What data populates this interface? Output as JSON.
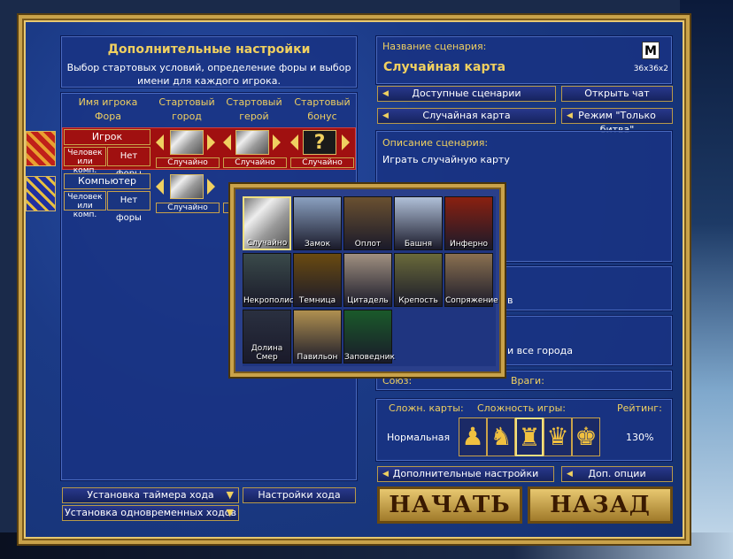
{
  "left": {
    "title": "Дополнительные настройки",
    "subtitle": "Выбор стартовых условий, определение форы и выбор имени для каждого игрока.",
    "columns": {
      "player": "Имя игрока\nФора",
      "town": "Стартовый\nгород",
      "hero": "Стартовый\nгерой",
      "bonus": "Стартовый\nбонус"
    },
    "players": [
      {
        "name": "Игрок",
        "type": "Человек\nили комп.",
        "handicap": "Нет форы",
        "town": "Случайно",
        "hero": "Случайно",
        "bonus": "Случайно",
        "flag_color": "#c0201a"
      },
      {
        "name": "Компьютер",
        "type": "Человек\nили комп.",
        "handicap": "Нет форы",
        "town": "Случайно",
        "hero": "",
        "bonus": "",
        "flag_color": "#2030a0"
      }
    ],
    "timer_label": "Установка таймера хода",
    "turn_settings": "Настройки хода",
    "simultaneous_label": "Установка одновременных ходов"
  },
  "right": {
    "scenario_name_label": "Название сценария:",
    "scenario_name": "Случайная карта",
    "map_size": "36x36x2",
    "map_icon_letter": "M",
    "available_scenarios": "Доступные сценарии",
    "open_chat": "Открыть чат",
    "random_map": "Случайная карта",
    "battle_only": "Режим \"Только битва\"",
    "description_label": "Описание сценария:",
    "description": "Играть случайную карту",
    "partial_text_1": "в",
    "partial_text_2": "и все города",
    "allies_label": "Союз:",
    "enemies_label": "Враги:",
    "map_difficulty_label": "Сложн. карты:",
    "game_difficulty_label": "Сложность игры:",
    "rating_label": "Рейтинг:",
    "map_difficulty": "Нормальная",
    "rating": "130%",
    "advanced_settings": "Дополнительные настройки",
    "extra_options": "Доп. опции",
    "start": "НАЧАТЬ",
    "back": "НАЗАД"
  },
  "towns": [
    {
      "name": "Случайно",
      "color": "#8a8a8a"
    },
    {
      "name": "Замок",
      "color": "#8aa0c0"
    },
    {
      "name": "Оплот",
      "color": "#6a5030"
    },
    {
      "name": "Башня",
      "color": "#b0c0d8"
    },
    {
      "name": "Инферно",
      "color": "#8a2010"
    },
    {
      "name": "Некрополис",
      "color": "#3a4a4a"
    },
    {
      "name": "Темница",
      "color": "#6a4a10"
    },
    {
      "name": "Цитадель",
      "color": "#a09080"
    },
    {
      "name": "Крепость",
      "color": "#6a6a3a"
    },
    {
      "name": "Сопряжение",
      "color": "#8a7050"
    },
    {
      "name": "Долина Смер",
      "color": "#2a3040"
    },
    {
      "name": "Павильон",
      "color": "#b09050"
    },
    {
      "name": "Заповедник",
      "color": "#1a5a2a"
    }
  ]
}
